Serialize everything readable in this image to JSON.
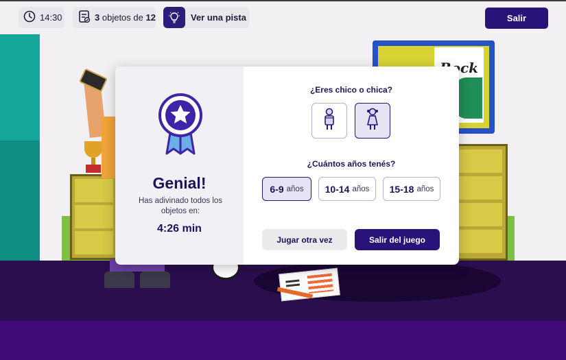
{
  "topbar": {
    "timer": {
      "icon": "clock-icon",
      "value": "14:30"
    },
    "objects": {
      "icon": "checklist-icon",
      "found": "3",
      "middle": "objetos de",
      "total": "12"
    },
    "hint": {
      "icon": "lightbulb-icon",
      "label": "Ver una pista"
    },
    "exit_label": "Salir"
  },
  "scene": {
    "poster_text": "Rock"
  },
  "modal": {
    "result": {
      "icon": "medal-star-icon",
      "title": "Genial!",
      "description": "Has adivinado todos los objetos en:",
      "time": "4:26 min"
    },
    "gender": {
      "question": "¿Eres chico o chica?",
      "options": [
        {
          "icon": "boy-icon",
          "selected": false
        },
        {
          "icon": "girl-icon",
          "selected": true
        }
      ]
    },
    "age": {
      "question": "¿Cuántos años tenés?",
      "options": [
        {
          "range": "6-9",
          "unit": "años",
          "selected": true
        },
        {
          "range": "10-14",
          "unit": "años",
          "selected": false
        },
        {
          "range": "15-18",
          "unit": "años",
          "selected": false
        }
      ]
    },
    "buttons": {
      "play_again": "Jugar otra vez",
      "quit_game": "Salir del juego"
    }
  },
  "colors": {
    "primary": "#2a1378",
    "heading": "#1c1359",
    "selected_bg": "#e6e3f4",
    "medal": "#3f24a8"
  }
}
